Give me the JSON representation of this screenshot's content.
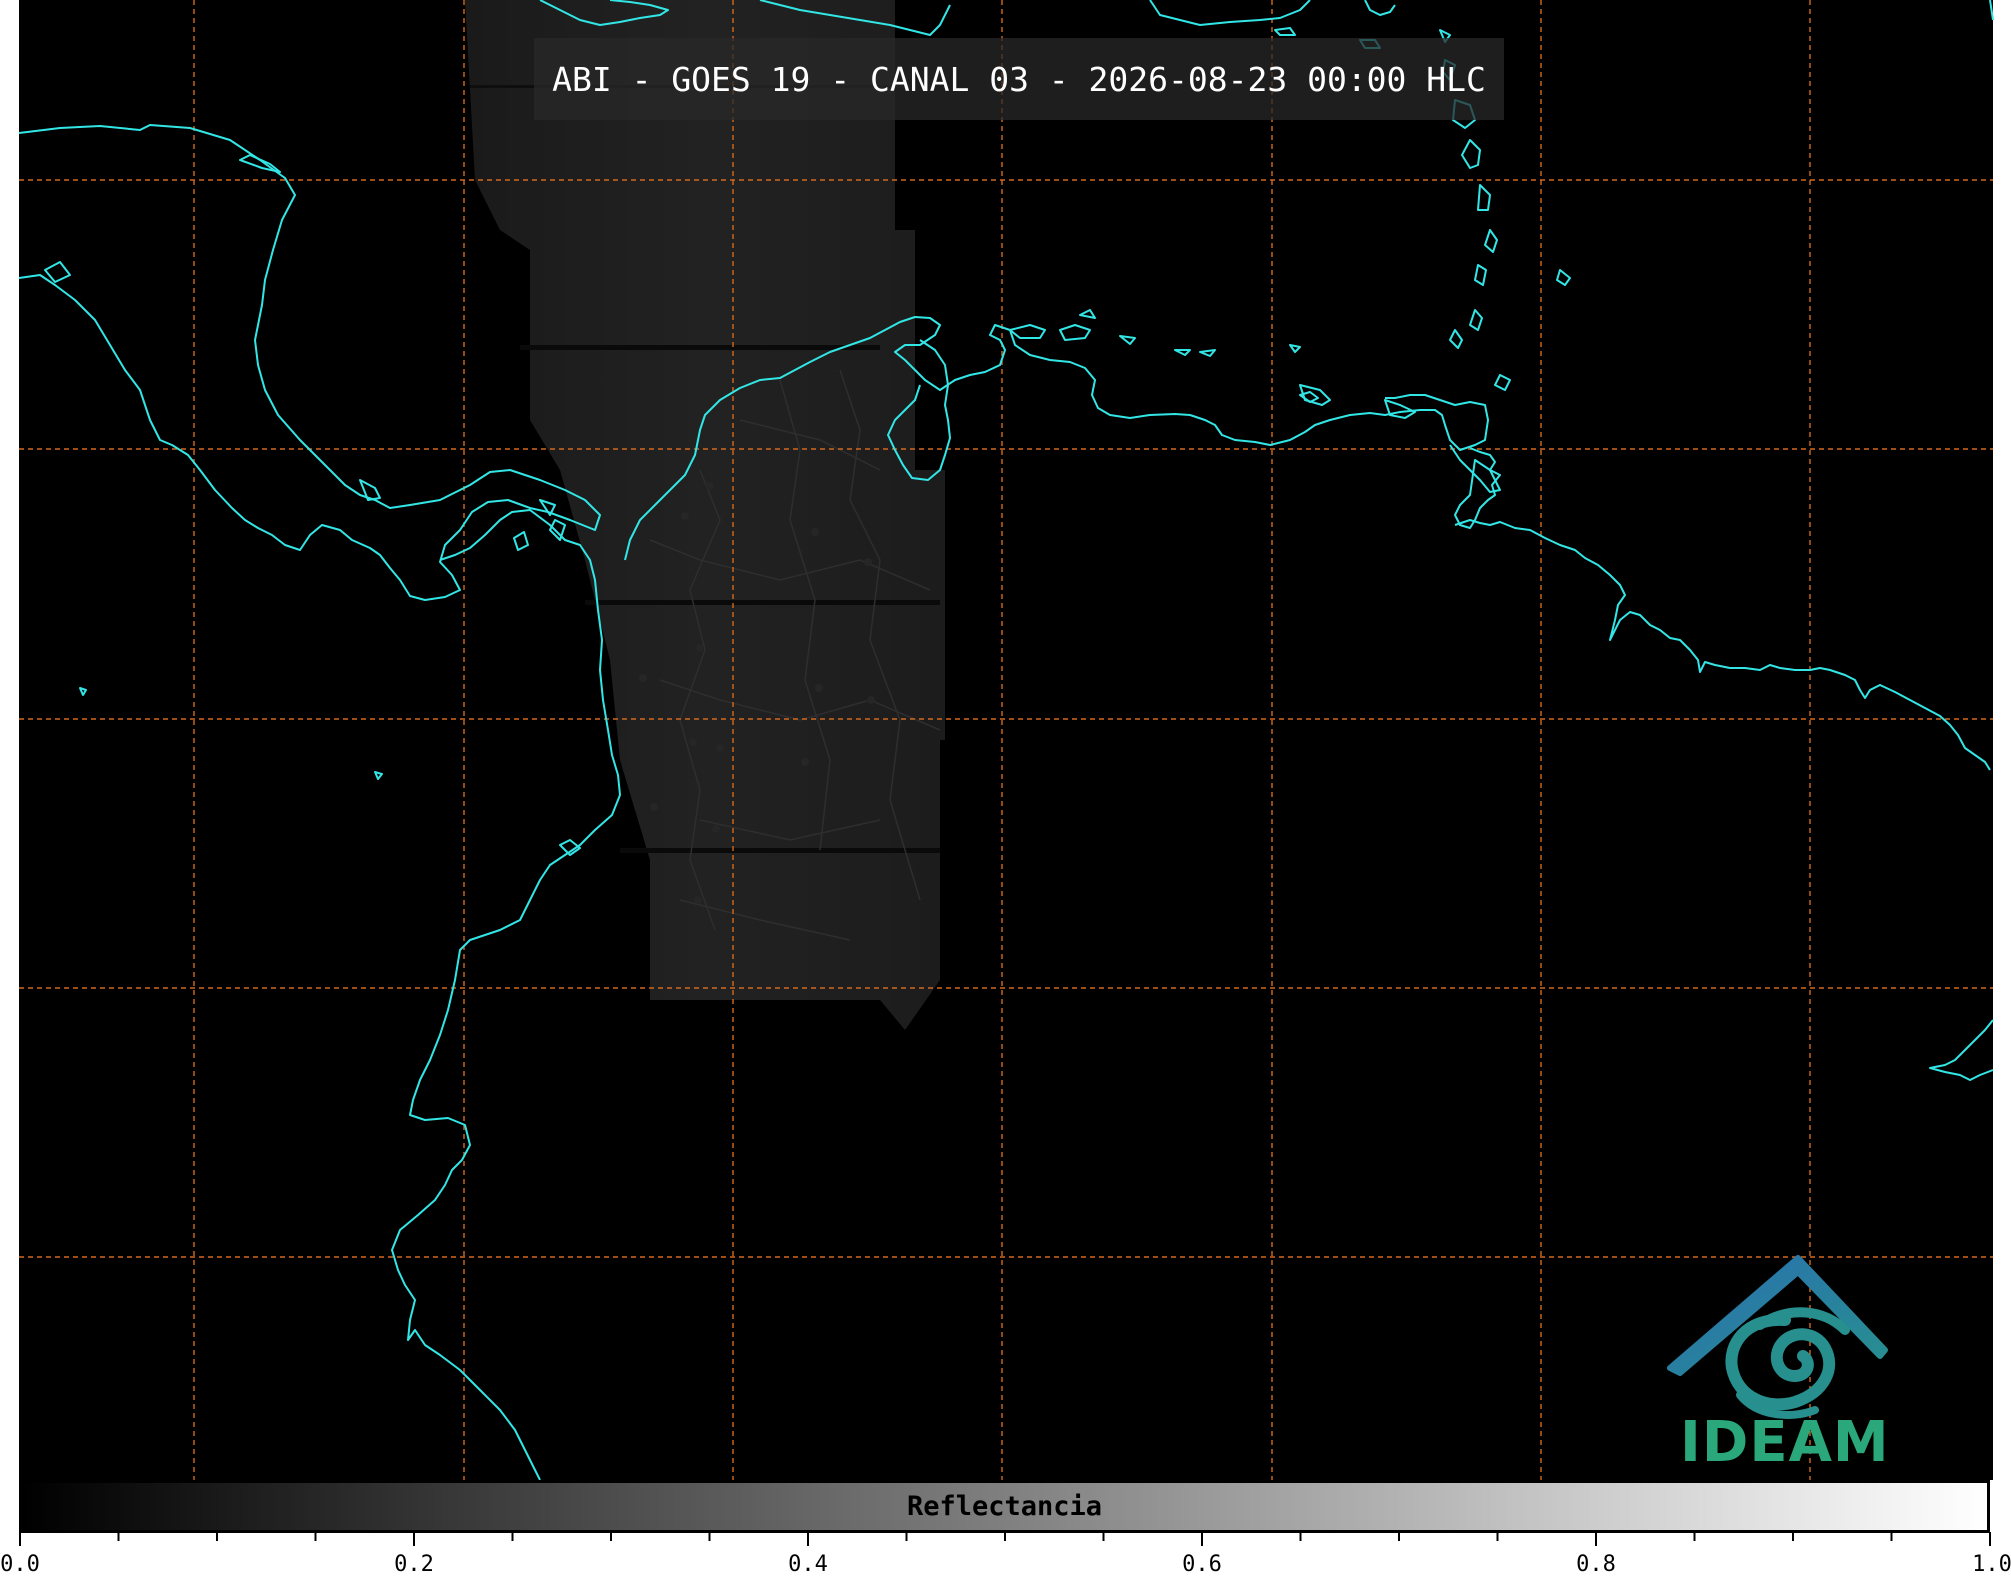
{
  "title": "ABI - GOES 19 - CANAL 03 - 2026-08-23 00:00 HLC",
  "logo": {
    "text": "IDEAM",
    "text_color": "#2aa87c",
    "roof_color": "#2a6fb0",
    "swirl_color": "#27908f"
  },
  "colorbar": {
    "label": "Reflectancia",
    "min": 0.0,
    "max": 1.0,
    "tick_labels": [
      "0.0",
      "0.2",
      "0.4",
      "0.6",
      "0.8",
      "1.0"
    ],
    "colormap": [
      "#000000",
      "#ffffff"
    ]
  },
  "colors": {
    "background": "#000000",
    "coastline": "#33e6e6",
    "gridline": "#d2691e",
    "borders": "#2e2e2e"
  },
  "icons": [
    "ideam-logo-icon"
  ]
}
